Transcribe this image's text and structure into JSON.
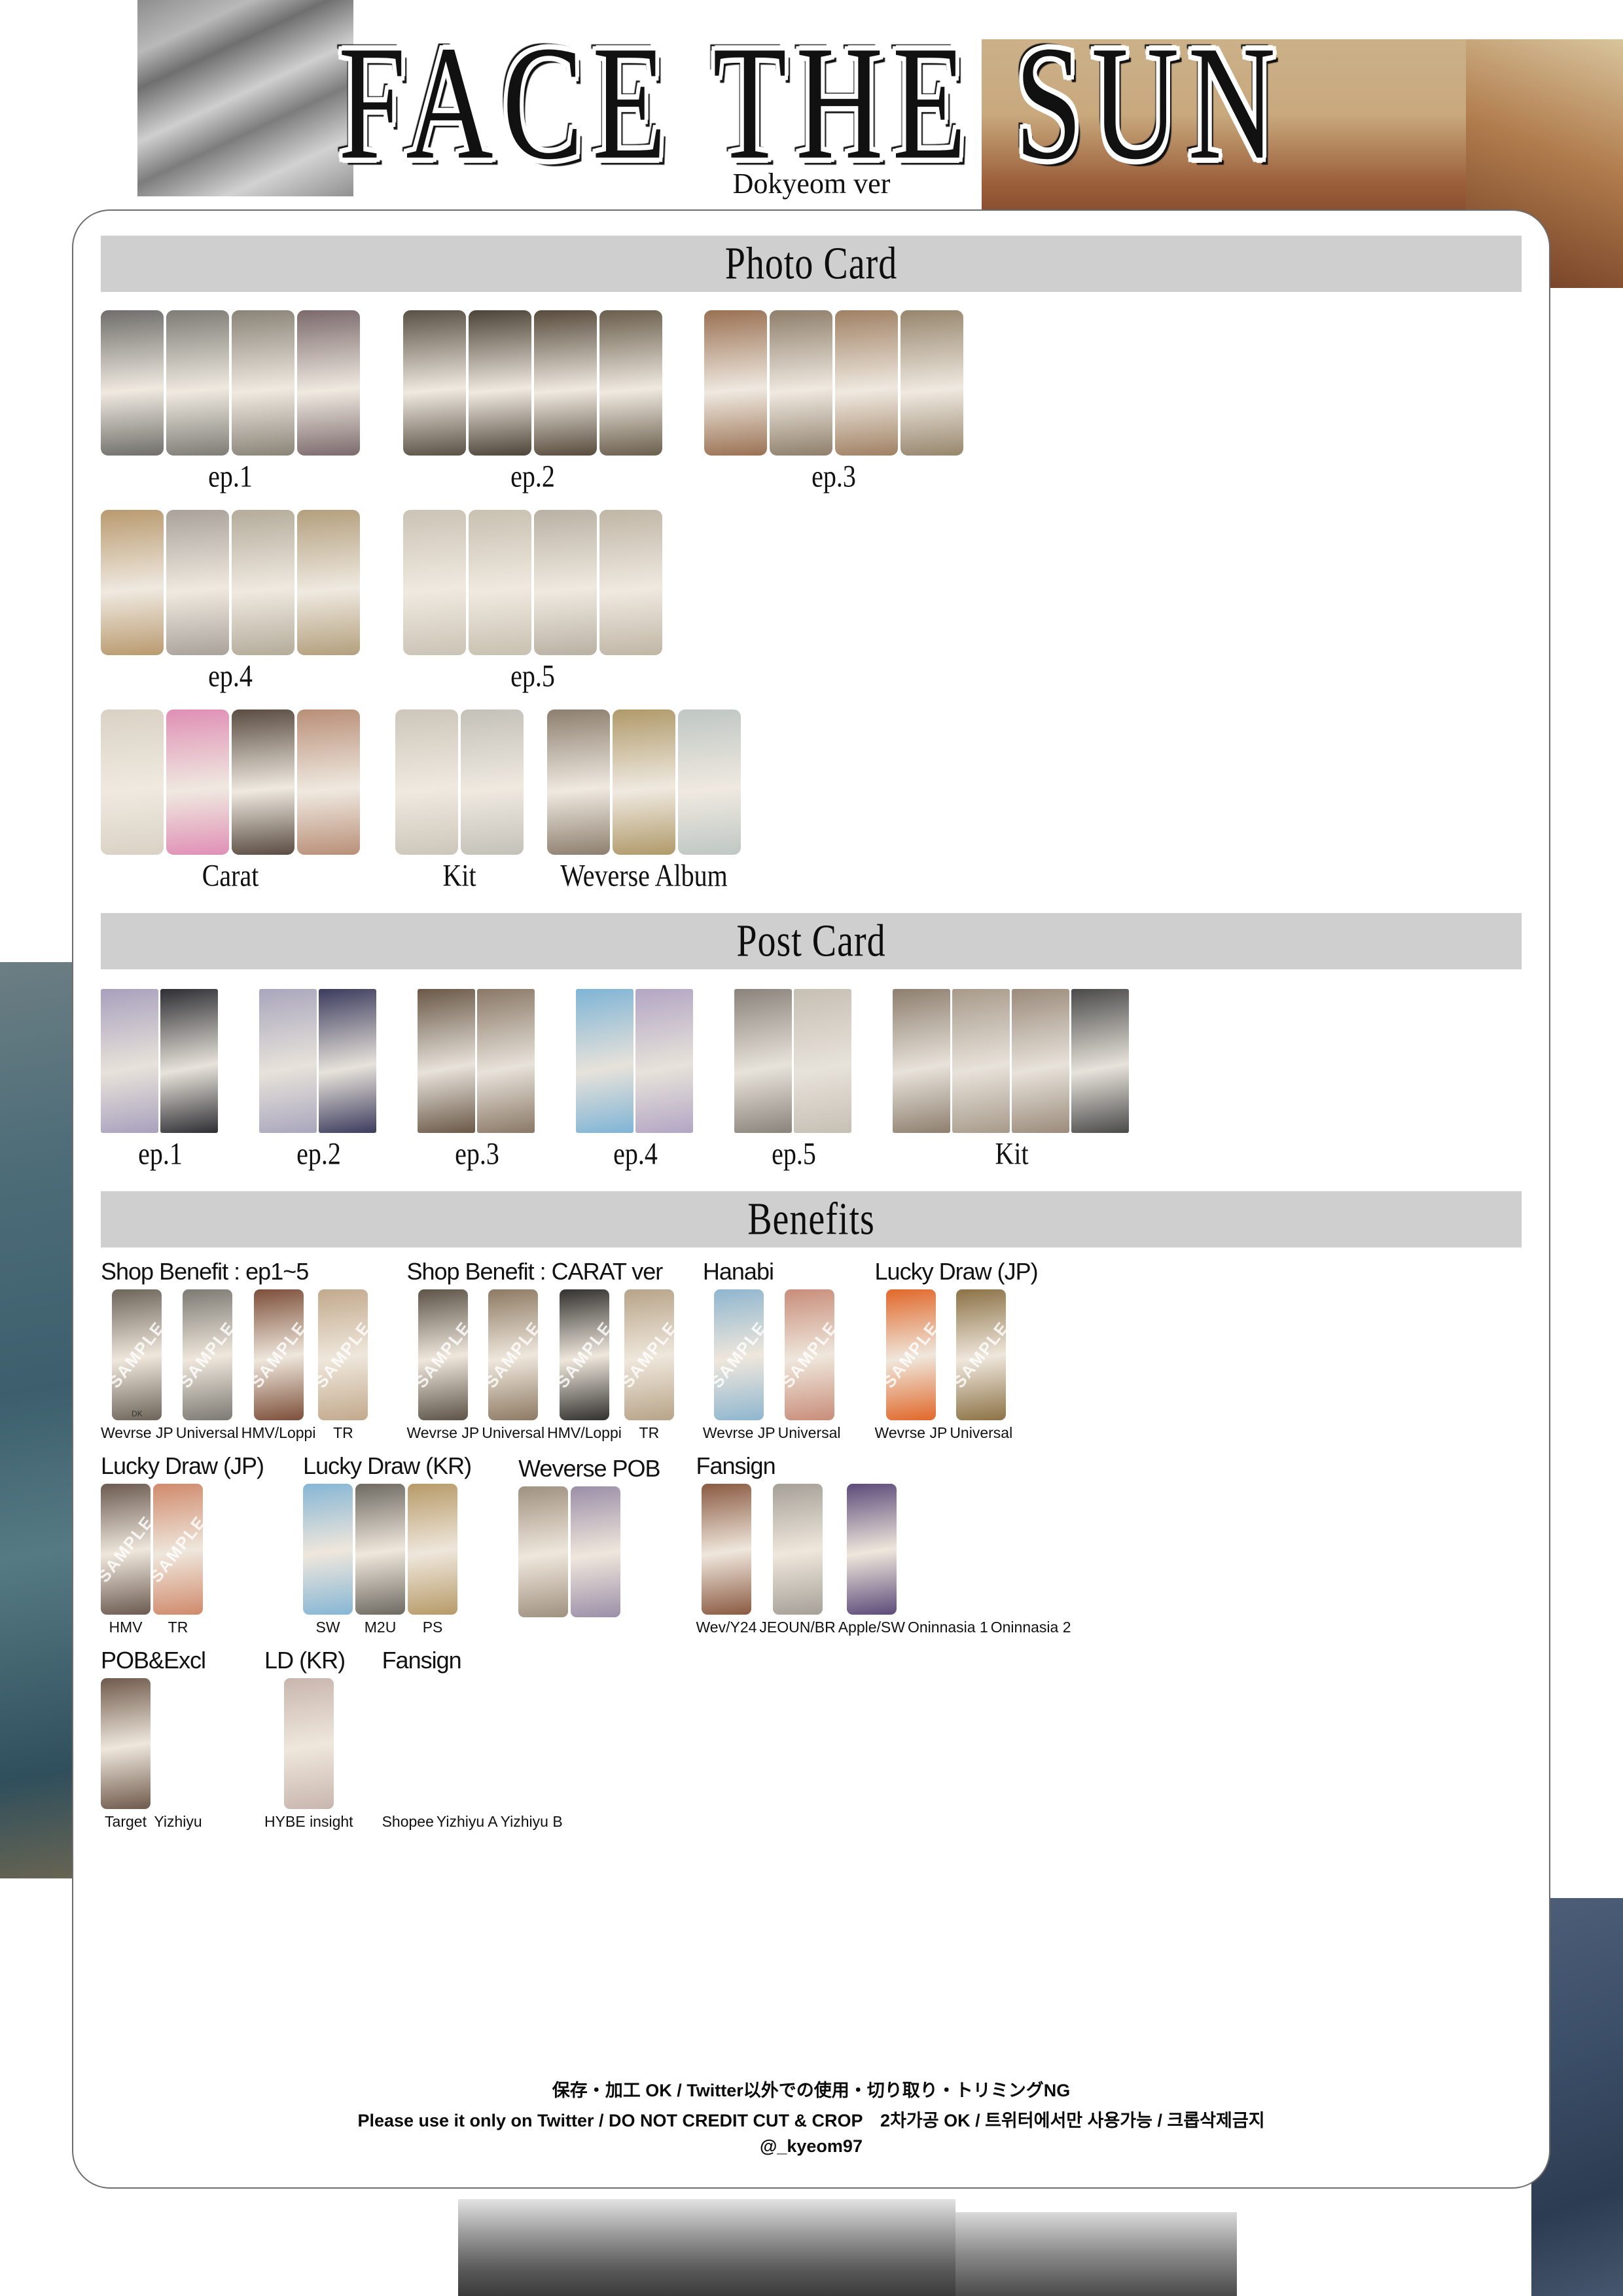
{
  "header": {
    "title": "FACE THE SUN",
    "subtitle": "Dokyeom ver"
  },
  "sections": {
    "photo_card": "Photo Card",
    "post_card": "Post Card",
    "benefits": "Benefits"
  },
  "photo_card": {
    "rows": [
      [
        {
          "label": "ep.1",
          "count": 4,
          "colors": [
            "#6f6e6a",
            "#7d7c75",
            "#8a8378",
            "#7c6a6d"
          ]
        },
        {
          "label": "ep.2",
          "count": 4,
          "colors": [
            "#5a5145",
            "#4d4438",
            "#574b3c",
            "#6a5e4c"
          ]
        },
        {
          "label": "ep.3",
          "count": 4,
          "colors": [
            "#9a7153",
            "#8f7f6b",
            "#a08164",
            "#97866d"
          ]
        }
      ],
      [
        {
          "label": "ep.4",
          "count": 4,
          "colors": [
            "#b99a6f",
            "#a9a29a",
            "#b4ab9a",
            "#b39f7d"
          ]
        },
        {
          "label": "ep.5",
          "count": 4,
          "colors": [
            "#cbc3b4",
            "#c8c0b0",
            "#b9b1a3",
            "#c0b6a6"
          ]
        }
      ],
      [
        {
          "label": "Carat",
          "count": 4,
          "colors": [
            "#d9d2c4",
            "#e08fb5",
            "#5a4c41",
            "#b98f78"
          ]
        },
        {
          "label": "Kit",
          "count": 2,
          "colors": [
            "#cdc6ba",
            "#c4c1b8"
          ]
        },
        {
          "label": "Weverse Album",
          "count": 3,
          "colors": [
            "#8d7f6f",
            "#b09a6a",
            "#bfc7c4"
          ]
        }
      ]
    ]
  },
  "post_card": {
    "groups": [
      {
        "label": "ep.1",
        "count": 2,
        "colors": [
          "#a9a0bd",
          "#2e2e33"
        ]
      },
      {
        "label": "ep.2",
        "count": 2,
        "colors": [
          "#a9a6bd",
          "#3b3b5e"
        ]
      },
      {
        "label": "ep.3",
        "count": 2,
        "colors": [
          "#6a5847",
          "#8a7866"
        ]
      },
      {
        "label": "ep.4",
        "count": 2,
        "colors": [
          "#7fb4d6",
          "#b2a6c4"
        ]
      },
      {
        "label": "ep.5",
        "count": 2,
        "colors": [
          "#8a837b",
          "#c6bfb4"
        ]
      },
      {
        "label": "Kit",
        "count": 4,
        "colors": [
          "#8e7f6f",
          "#a79a8a",
          "#9b8b7b",
          "#4a4a4a"
        ]
      }
    ]
  },
  "benefits": {
    "rows": [
      [
        {
          "title": "Shop Benefit : ep1~5",
          "items": [
            {
              "label": "Wevrse JP",
              "sample": true,
              "dk": "DK",
              "color": "#6d6559"
            },
            {
              "label": "Universal",
              "sample": true,
              "color": "#7d7a73"
            },
            {
              "label": "HMV/Loppi",
              "sample": true,
              "color": "#7d4f3a"
            },
            {
              "label": "TR",
              "sample": true,
              "color": "#c2a98c"
            }
          ]
        },
        {
          "title": "Shop Benefit : CARAT ver",
          "items": [
            {
              "label": "Wevrse JP",
              "sample": true,
              "color": "#5d5347"
            },
            {
              "label": "Universal",
              "sample": true,
              "color": "#8d7a63"
            },
            {
              "label": "HMV/Loppi",
              "sample": true,
              "color": "#32312f"
            },
            {
              "label": "TR",
              "sample": true,
              "color": "#b7a488"
            }
          ]
        },
        {
          "title": "Hanabi",
          "items": [
            {
              "label": "Wevrse JP",
              "sample": true,
              "color": "#8fb6cf"
            },
            {
              "label": "Universal",
              "sample": true,
              "color": "#c98d7a"
            }
          ]
        },
        {
          "title": "Lucky Draw (JP)",
          "items": [
            {
              "label": "Wevrse JP",
              "sample": true,
              "color": "#e1682a"
            },
            {
              "label": "Universal",
              "sample": true,
              "color": "#8c7246"
            }
          ]
        }
      ],
      [
        {
          "title": "Lucky Draw (JP)",
          "items": [
            {
              "label": "HMV",
              "sample": true,
              "color": "#6b5a50"
            },
            {
              "label": "TR",
              "sample": true,
              "color": "#d08a6c"
            }
          ]
        },
        {
          "title": "Lucky Draw (KR)",
          "items": [
            {
              "label": "SW",
              "sample": false,
              "color": "#86b6d5"
            },
            {
              "label": "M2U",
              "sample": false,
              "color": "#6e6a62"
            },
            {
              "label": "PS",
              "sample": false,
              "color": "#b79a68"
            }
          ]
        },
        {
          "title": "Weverse POB",
          "items": [
            {
              "label": "",
              "sample": false,
              "color": "#a09180"
            },
            {
              "label": "",
              "sample": false,
              "color": "#9b8fa8"
            }
          ]
        },
        {
          "title": "Fansign",
          "items": [
            {
              "label": "Wev/Y24",
              "sample": false,
              "color": "#8b5a42"
            },
            {
              "label": "JEOUN/BR",
              "sample": false,
              "color": "#a5a098"
            },
            {
              "label": "Apple/SW",
              "sample": false,
              "color": "#5c4b7a"
            },
            {
              "label": "Oninnasia 1",
              "sample": false,
              "color": null
            },
            {
              "label": "Oninnasia 2",
              "sample": false,
              "color": null
            }
          ]
        }
      ],
      [
        {
          "title": "POB&Excl",
          "items": [
            {
              "label": "Target",
              "sample": false,
              "color": "#6f5a4c"
            },
            {
              "label": "Yizhiyu",
              "sample": false,
              "color": null
            }
          ]
        },
        {
          "title": "LD (KR)",
          "items": [
            {
              "label": "HYBE insight",
              "sample": false,
              "color": "#c8b6ad"
            }
          ]
        },
        {
          "title": "Fansign",
          "items": [
            {
              "label": "Shopee",
              "sample": false,
              "color": null
            },
            {
              "label": "Yizhiyu A",
              "sample": false,
              "color": null
            },
            {
              "label": "Yizhiyu B",
              "sample": false,
              "color": null
            }
          ]
        }
      ]
    ]
  },
  "footer": {
    "line1": "保存・加工 OK / Twitter以外での使用・切り取り・トリミングNG",
    "line2": "Please use it only on Twitter / DO NOT CREDIT CUT & CROP　2차가공 OK / 트위터에서만 사용가능 / 크롭삭제금지",
    "line3": "@_kyeom97"
  },
  "colors": {
    "band": "#cfcfcf",
    "sheet_border": "#6d6d6d",
    "text": "#111111"
  }
}
